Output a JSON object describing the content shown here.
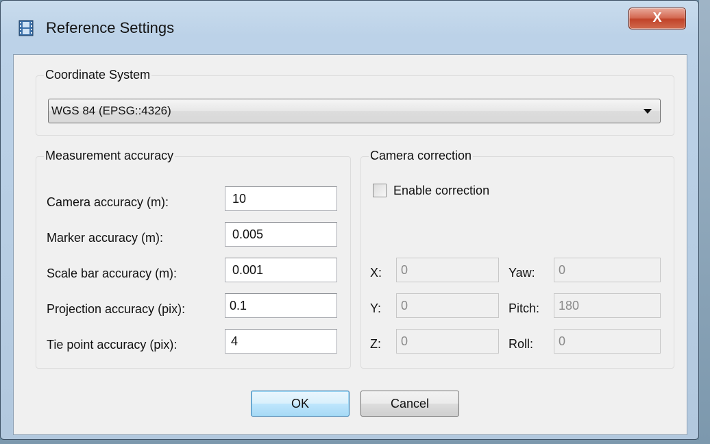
{
  "window": {
    "title": "Reference Settings",
    "close_glyph": "X",
    "icon": "film-strip-icon"
  },
  "coordinate_system": {
    "group_title": "Coordinate System",
    "selected": "WGS 84 (EPSG::4326)"
  },
  "measurement_accuracy": {
    "group_title": "Measurement accuracy",
    "fields": [
      {
        "label": "Camera accuracy (m):",
        "value": "10"
      },
      {
        "label": "Marker accuracy (m):",
        "value": "0.005"
      },
      {
        "label": "Scale bar accuracy (m):",
        "value": "0.001"
      },
      {
        "label": "Projection accuracy (pix):",
        "value": "0.1"
      },
      {
        "label": "Tie point accuracy (pix):",
        "value": "4"
      }
    ]
  },
  "camera_correction": {
    "group_title": "Camera correction",
    "enable_label": "Enable correction",
    "enabled": false,
    "fields": {
      "x": {
        "label": "X:",
        "value": "0"
      },
      "y": {
        "label": "Y:",
        "value": "0"
      },
      "z": {
        "label": "Z:",
        "value": "0"
      },
      "yaw": {
        "label": "Yaw:",
        "value": "0"
      },
      "pitch": {
        "label": "Pitch:",
        "value": "180"
      },
      "roll": {
        "label": "Roll:",
        "value": "0"
      }
    }
  },
  "buttons": {
    "ok": "OK",
    "cancel": "Cancel"
  },
  "colors": {
    "close_button": "#c1442a",
    "default_button": "#bee6fd",
    "title_bar": "#bcd2e8"
  }
}
